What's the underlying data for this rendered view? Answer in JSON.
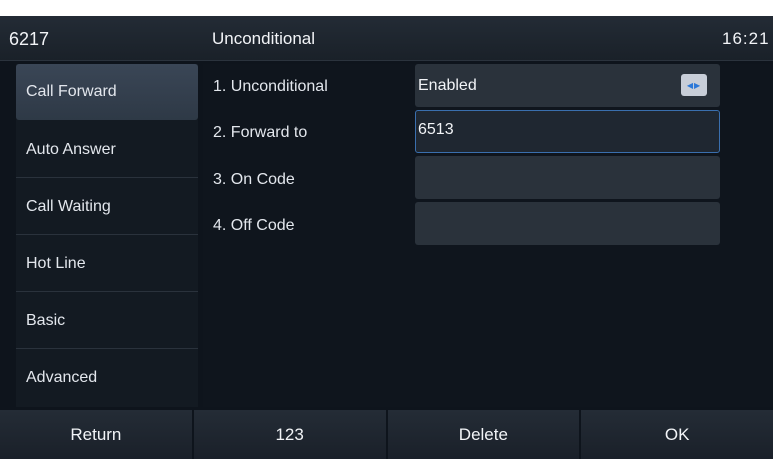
{
  "status_bar": {
    "extension": "6217",
    "title": "Unconditional",
    "time": "16:21"
  },
  "menu": {
    "items": [
      {
        "label": "Call Forward"
      },
      {
        "label": "Auto Answer"
      },
      {
        "label": "Call Waiting"
      },
      {
        "label": "Hot Line"
      },
      {
        "label": "Basic"
      },
      {
        "label": "Advanced"
      }
    ]
  },
  "settings": {
    "rows": [
      {
        "label": "1. Unconditional",
        "value": "Enabled"
      },
      {
        "label": "2. Forward to",
        "value": "6513"
      },
      {
        "label": "3. On Code",
        "value": ""
      },
      {
        "label": "4. Off Code",
        "value": ""
      }
    ]
  },
  "softkeys": {
    "return_label": "Return",
    "input_mode_label": "123",
    "delete_label": "Delete",
    "ok_label": "OK"
  },
  "colors": {
    "focus_border": "#3a6fae",
    "switch_arrow": "#2b78d8"
  },
  "icons": {
    "option_switch": "left-right-arrows-icon"
  }
}
